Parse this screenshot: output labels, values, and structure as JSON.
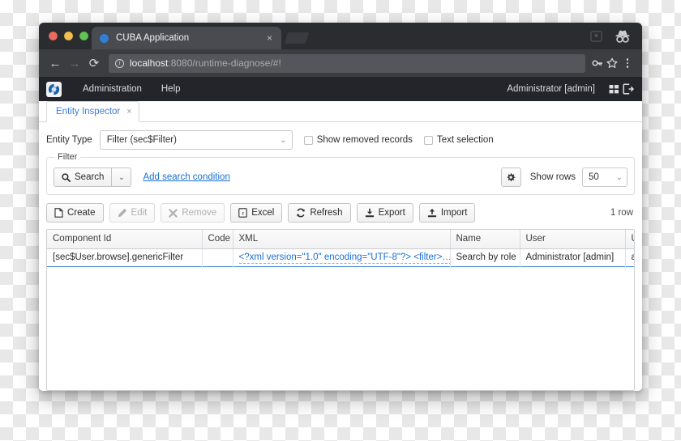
{
  "browser": {
    "tab": {
      "title": "CUBA Application",
      "close_label": "×",
      "favicon": "globe-icon"
    },
    "nav": {
      "back": "←",
      "forward": "→",
      "reload": "⟳"
    },
    "address": {
      "host": "localhost",
      "rest": ":8080/runtime-diagnose/#!",
      "info_icon": "info-icon"
    },
    "omnibox_icons": {
      "key": "🔑",
      "star": "☆"
    },
    "menu_icon": "kebab-menu-icon",
    "incognito_icon": "incognito-icon"
  },
  "app_header": {
    "logo": "cuba-logo-icon",
    "menus": [
      {
        "label": "Administration"
      },
      {
        "label": "Help"
      }
    ],
    "user": "Administrator [admin]",
    "grid_icon": "apps-grid-icon",
    "logout_icon": "logout-icon"
  },
  "app_tabs": [
    {
      "label": "Entity Inspector",
      "close": "×",
      "active": true
    }
  ],
  "entity_row": {
    "label": "Entity Type",
    "select_value": "Filter (sec$Filter)",
    "caret": "⌄",
    "checkboxes": [
      {
        "label": "Show removed records",
        "checked": false
      },
      {
        "label": "Text selection",
        "checked": false
      }
    ]
  },
  "filter_panel": {
    "legend": "Filter",
    "search_label": "Search",
    "search_icon": "magnifier-icon",
    "split_caret": "⌄",
    "add_condition_link": "Add search condition",
    "gear_icon": "gear-icon",
    "show_rows_label": "Show rows",
    "show_rows_value": "50",
    "show_rows_caret": "⌄"
  },
  "toolbar": {
    "buttons": [
      {
        "label": "Create",
        "icon": "file-plus-icon",
        "disabled": false
      },
      {
        "label": "Edit",
        "icon": "pencil-icon",
        "disabled": true
      },
      {
        "label": "Remove",
        "icon": "x-cross-icon",
        "disabled": true
      },
      {
        "label": "Excel",
        "icon": "excel-sheet-icon",
        "disabled": false
      },
      {
        "label": "Refresh",
        "icon": "refresh-icon",
        "disabled": false
      },
      {
        "label": "Export",
        "icon": "download-icon",
        "disabled": false
      },
      {
        "label": "Import",
        "icon": "upload-icon",
        "disabled": false
      }
    ],
    "row_count": "1 row"
  },
  "table": {
    "columns": [
      {
        "key": "component_id",
        "label": "Component Id"
      },
      {
        "key": "code",
        "label": "Code"
      },
      {
        "key": "xml",
        "label": "XML"
      },
      {
        "key": "name",
        "label": "Name"
      },
      {
        "key": "user",
        "label": "User"
      },
      {
        "key": "u_cut",
        "label": "U"
      }
    ],
    "rows": [
      {
        "component_id": "[sec$User.browse].genericFilter",
        "code": "",
        "xml": "<?xml version=\"1.0\" encoding=\"UTF-8\"?> <filter>…",
        "name": "Search by role",
        "user": "Administrator [admin]",
        "u_cut": "a"
      }
    ]
  },
  "colors": {
    "link": "#1a6fd4",
    "tab_active_text": "#3b7dd8",
    "row_highlight_border": "#4a90d9",
    "header_bg": "#23252b",
    "browser_chrome": "#3c3d41"
  }
}
